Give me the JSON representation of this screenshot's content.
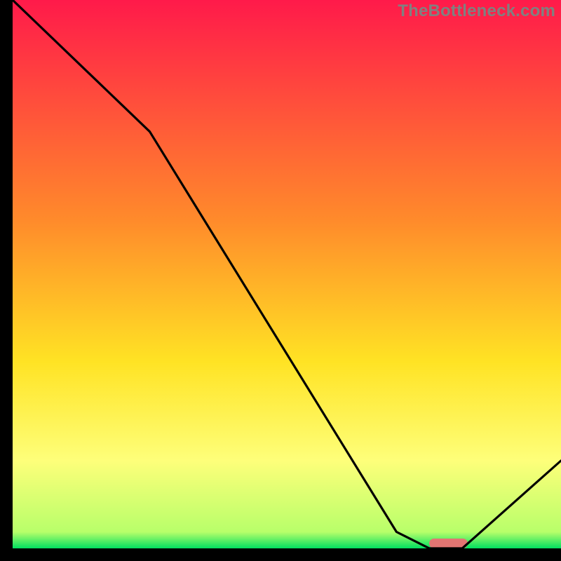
{
  "watermark": "TheBottleneck.com",
  "colors": {
    "axis": "#000000",
    "curve": "#000000",
    "marker": "#e37572",
    "gradient_top": "#ff1a4a",
    "gradient_mid1": "#ff8a2b",
    "gradient_mid2": "#ffe324",
    "gradient_mid3": "#feff7a",
    "gradient_bottom": "#00e060"
  },
  "chart_data": {
    "type": "line",
    "title": "",
    "xlabel": "",
    "ylabel": "",
    "xlim": [
      0,
      100
    ],
    "ylim": [
      0,
      100
    ],
    "x": [
      0,
      25,
      70,
      76,
      82,
      100
    ],
    "values": [
      100,
      76,
      3,
      0,
      0,
      16
    ],
    "optimal_marker": {
      "x_start": 76,
      "x_end": 83,
      "y": 0
    },
    "curve_color": "#000000",
    "background_gradient": {
      "stops": [
        {
          "pos": 0.0,
          "color": "#ff1a4a"
        },
        {
          "pos": 0.4,
          "color": "#ff8a2b"
        },
        {
          "pos": 0.66,
          "color": "#ffe324"
        },
        {
          "pos": 0.84,
          "color": "#feff7a"
        },
        {
          "pos": 0.97,
          "color": "#b8ff6a"
        },
        {
          "pos": 1.0,
          "color": "#00e060"
        }
      ]
    }
  }
}
